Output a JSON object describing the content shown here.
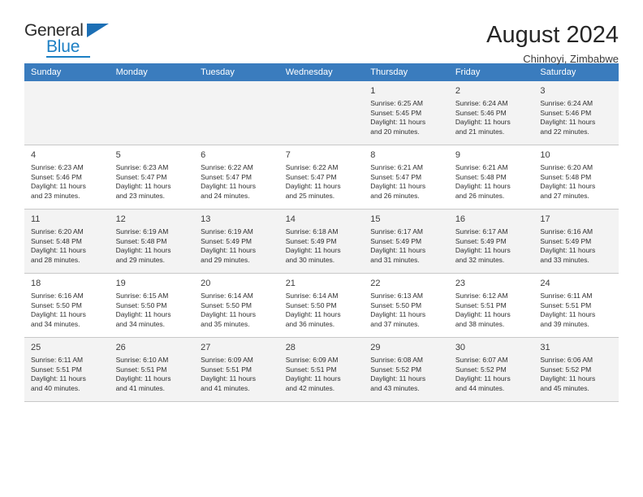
{
  "brand": {
    "name_top": "General",
    "name_bottom": "Blue",
    "flag_icon": "triangle-flag-icon",
    "accent_color": "#1c7fc4"
  },
  "header": {
    "title": "August 2024",
    "location": "Chinhoyi, Zimbabwe"
  },
  "calendar": {
    "header_bg": "#3a7cbe",
    "header_text_color": "#ffffff",
    "shaded_row_bg": "#f3f3f3",
    "weekdays": [
      "Sunday",
      "Monday",
      "Tuesday",
      "Wednesday",
      "Thursday",
      "Friday",
      "Saturday"
    ],
    "weeks": [
      [
        {
          "day": "",
          "sunrise": "",
          "sunset": "",
          "daylight1": "",
          "daylight2": ""
        },
        {
          "day": "",
          "sunrise": "",
          "sunset": "",
          "daylight1": "",
          "daylight2": ""
        },
        {
          "day": "",
          "sunrise": "",
          "sunset": "",
          "daylight1": "",
          "daylight2": ""
        },
        {
          "day": "",
          "sunrise": "",
          "sunset": "",
          "daylight1": "",
          "daylight2": ""
        },
        {
          "day": "1",
          "sunrise": "Sunrise: 6:25 AM",
          "sunset": "Sunset: 5:45 PM",
          "daylight1": "Daylight: 11 hours",
          "daylight2": "and 20 minutes."
        },
        {
          "day": "2",
          "sunrise": "Sunrise: 6:24 AM",
          "sunset": "Sunset: 5:46 PM",
          "daylight1": "Daylight: 11 hours",
          "daylight2": "and 21 minutes."
        },
        {
          "day": "3",
          "sunrise": "Sunrise: 6:24 AM",
          "sunset": "Sunset: 5:46 PM",
          "daylight1": "Daylight: 11 hours",
          "daylight2": "and 22 minutes."
        }
      ],
      [
        {
          "day": "4",
          "sunrise": "Sunrise: 6:23 AM",
          "sunset": "Sunset: 5:46 PM",
          "daylight1": "Daylight: 11 hours",
          "daylight2": "and 23 minutes."
        },
        {
          "day": "5",
          "sunrise": "Sunrise: 6:23 AM",
          "sunset": "Sunset: 5:47 PM",
          "daylight1": "Daylight: 11 hours",
          "daylight2": "and 23 minutes."
        },
        {
          "day": "6",
          "sunrise": "Sunrise: 6:22 AM",
          "sunset": "Sunset: 5:47 PM",
          "daylight1": "Daylight: 11 hours",
          "daylight2": "and 24 minutes."
        },
        {
          "day": "7",
          "sunrise": "Sunrise: 6:22 AM",
          "sunset": "Sunset: 5:47 PM",
          "daylight1": "Daylight: 11 hours",
          "daylight2": "and 25 minutes."
        },
        {
          "day": "8",
          "sunrise": "Sunrise: 6:21 AM",
          "sunset": "Sunset: 5:47 PM",
          "daylight1": "Daylight: 11 hours",
          "daylight2": "and 26 minutes."
        },
        {
          "day": "9",
          "sunrise": "Sunrise: 6:21 AM",
          "sunset": "Sunset: 5:48 PM",
          "daylight1": "Daylight: 11 hours",
          "daylight2": "and 26 minutes."
        },
        {
          "day": "10",
          "sunrise": "Sunrise: 6:20 AM",
          "sunset": "Sunset: 5:48 PM",
          "daylight1": "Daylight: 11 hours",
          "daylight2": "and 27 minutes."
        }
      ],
      [
        {
          "day": "11",
          "sunrise": "Sunrise: 6:20 AM",
          "sunset": "Sunset: 5:48 PM",
          "daylight1": "Daylight: 11 hours",
          "daylight2": "and 28 minutes."
        },
        {
          "day": "12",
          "sunrise": "Sunrise: 6:19 AM",
          "sunset": "Sunset: 5:48 PM",
          "daylight1": "Daylight: 11 hours",
          "daylight2": "and 29 minutes."
        },
        {
          "day": "13",
          "sunrise": "Sunrise: 6:19 AM",
          "sunset": "Sunset: 5:49 PM",
          "daylight1": "Daylight: 11 hours",
          "daylight2": "and 29 minutes."
        },
        {
          "day": "14",
          "sunrise": "Sunrise: 6:18 AM",
          "sunset": "Sunset: 5:49 PM",
          "daylight1": "Daylight: 11 hours",
          "daylight2": "and 30 minutes."
        },
        {
          "day": "15",
          "sunrise": "Sunrise: 6:17 AM",
          "sunset": "Sunset: 5:49 PM",
          "daylight1": "Daylight: 11 hours",
          "daylight2": "and 31 minutes."
        },
        {
          "day": "16",
          "sunrise": "Sunrise: 6:17 AM",
          "sunset": "Sunset: 5:49 PM",
          "daylight1": "Daylight: 11 hours",
          "daylight2": "and 32 minutes."
        },
        {
          "day": "17",
          "sunrise": "Sunrise: 6:16 AM",
          "sunset": "Sunset: 5:49 PM",
          "daylight1": "Daylight: 11 hours",
          "daylight2": "and 33 minutes."
        }
      ],
      [
        {
          "day": "18",
          "sunrise": "Sunrise: 6:16 AM",
          "sunset": "Sunset: 5:50 PM",
          "daylight1": "Daylight: 11 hours",
          "daylight2": "and 34 minutes."
        },
        {
          "day": "19",
          "sunrise": "Sunrise: 6:15 AM",
          "sunset": "Sunset: 5:50 PM",
          "daylight1": "Daylight: 11 hours",
          "daylight2": "and 34 minutes."
        },
        {
          "day": "20",
          "sunrise": "Sunrise: 6:14 AM",
          "sunset": "Sunset: 5:50 PM",
          "daylight1": "Daylight: 11 hours",
          "daylight2": "and 35 minutes."
        },
        {
          "day": "21",
          "sunrise": "Sunrise: 6:14 AM",
          "sunset": "Sunset: 5:50 PM",
          "daylight1": "Daylight: 11 hours",
          "daylight2": "and 36 minutes."
        },
        {
          "day": "22",
          "sunrise": "Sunrise: 6:13 AM",
          "sunset": "Sunset: 5:50 PM",
          "daylight1": "Daylight: 11 hours",
          "daylight2": "and 37 minutes."
        },
        {
          "day": "23",
          "sunrise": "Sunrise: 6:12 AM",
          "sunset": "Sunset: 5:51 PM",
          "daylight1": "Daylight: 11 hours",
          "daylight2": "and 38 minutes."
        },
        {
          "day": "24",
          "sunrise": "Sunrise: 6:11 AM",
          "sunset": "Sunset: 5:51 PM",
          "daylight1": "Daylight: 11 hours",
          "daylight2": "and 39 minutes."
        }
      ],
      [
        {
          "day": "25",
          "sunrise": "Sunrise: 6:11 AM",
          "sunset": "Sunset: 5:51 PM",
          "daylight1": "Daylight: 11 hours",
          "daylight2": "and 40 minutes."
        },
        {
          "day": "26",
          "sunrise": "Sunrise: 6:10 AM",
          "sunset": "Sunset: 5:51 PM",
          "daylight1": "Daylight: 11 hours",
          "daylight2": "and 41 minutes."
        },
        {
          "day": "27",
          "sunrise": "Sunrise: 6:09 AM",
          "sunset": "Sunset: 5:51 PM",
          "daylight1": "Daylight: 11 hours",
          "daylight2": "and 41 minutes."
        },
        {
          "day": "28",
          "sunrise": "Sunrise: 6:09 AM",
          "sunset": "Sunset: 5:51 PM",
          "daylight1": "Daylight: 11 hours",
          "daylight2": "and 42 minutes."
        },
        {
          "day": "29",
          "sunrise": "Sunrise: 6:08 AM",
          "sunset": "Sunset: 5:52 PM",
          "daylight1": "Daylight: 11 hours",
          "daylight2": "and 43 minutes."
        },
        {
          "day": "30",
          "sunrise": "Sunrise: 6:07 AM",
          "sunset": "Sunset: 5:52 PM",
          "daylight1": "Daylight: 11 hours",
          "daylight2": "and 44 minutes."
        },
        {
          "day": "31",
          "sunrise": "Sunrise: 6:06 AM",
          "sunset": "Sunset: 5:52 PM",
          "daylight1": "Daylight: 11 hours",
          "daylight2": "and 45 minutes."
        }
      ]
    ]
  }
}
